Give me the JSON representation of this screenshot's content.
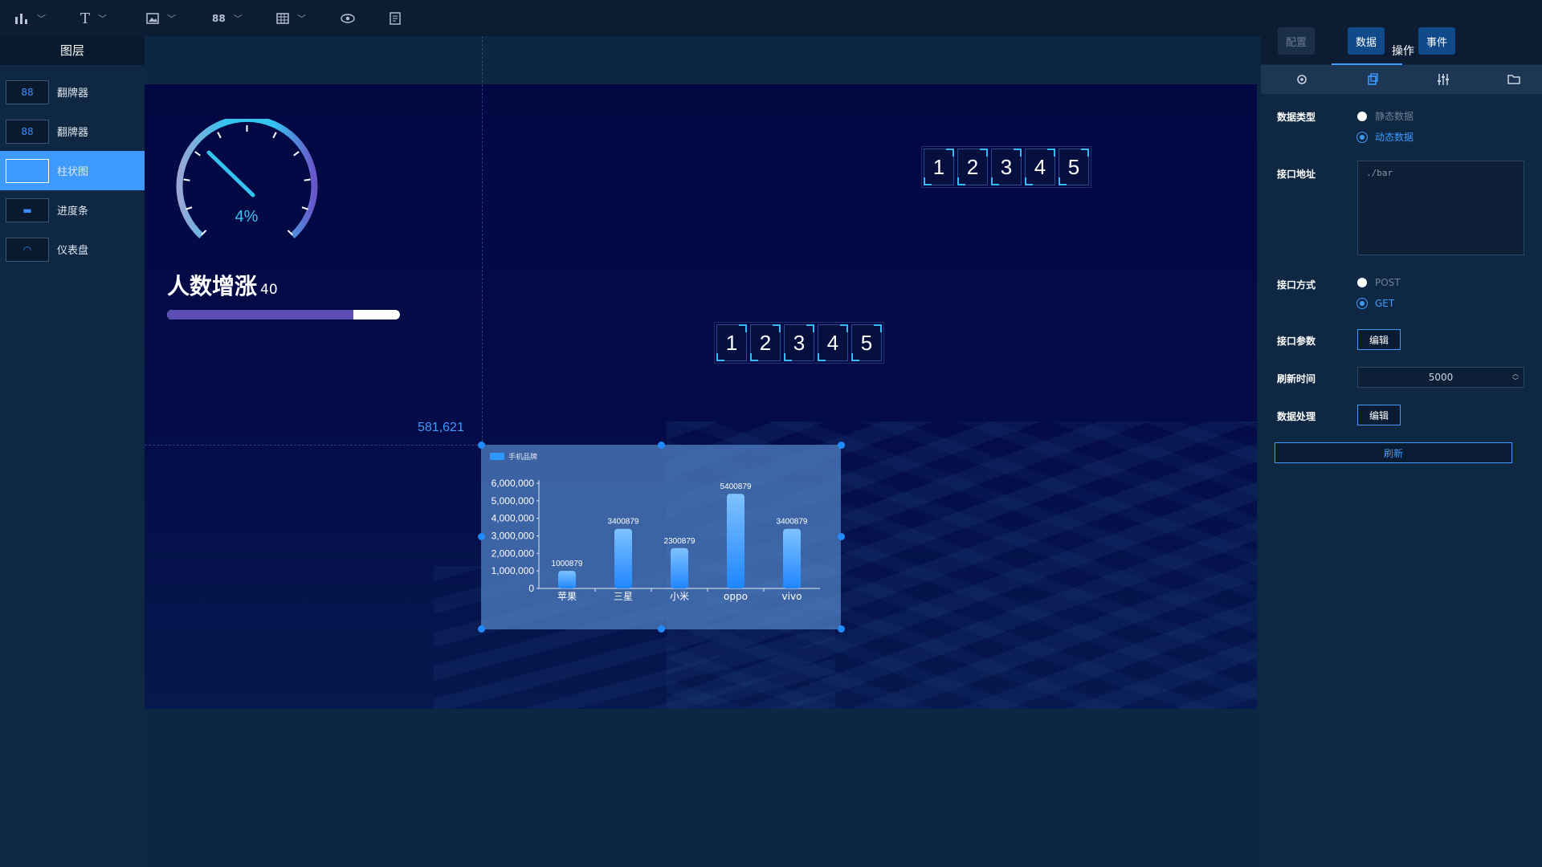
{
  "toolbar": {
    "tools": [
      {
        "icon": "bar-chart-icon"
      },
      {
        "icon": "text-icon",
        "glyph": "T"
      },
      {
        "icon": "image-icon"
      },
      {
        "icon": "flipper-icon",
        "glyph": "88"
      },
      {
        "icon": "table-icon"
      },
      {
        "icon": "eye-icon"
      },
      {
        "icon": "document-icon"
      }
    ]
  },
  "layers": {
    "title": "图层",
    "items": [
      {
        "label": "翻牌器",
        "thumb": "88"
      },
      {
        "label": "翻牌器",
        "thumb": "88"
      },
      {
        "label": "柱状图",
        "thumb": ""
      },
      {
        "label": "进度条",
        "thumb": "▬"
      },
      {
        "label": "仪表盘",
        "thumb": "◠"
      }
    ],
    "active_index": 2
  },
  "canvas": {
    "gauge_value": "4%",
    "title": "人数增涨",
    "title_value": "40",
    "progress_percent": 80,
    "coord_readout": "581,621",
    "flipper_top": [
      "1",
      "2",
      "3",
      "4",
      "5"
    ],
    "flipper_mid": [
      "1",
      "2",
      "3",
      "4",
      "5"
    ]
  },
  "chart_data": {
    "type": "bar",
    "legend": "手机品牌",
    "categories": [
      "苹果",
      "三星",
      "小米",
      "oppo",
      "vivo"
    ],
    "values": [
      1000879,
      3400879,
      2300879,
      5400879,
      3400879
    ],
    "value_labels": [
      "1000879",
      "3400879",
      "2300879",
      "5400879",
      "3400879"
    ],
    "y_ticks": [
      "0",
      "1,000,000",
      "2,000,000",
      "3,000,000",
      "4,000,000",
      "5,000,000",
      "6,000,000"
    ],
    "ylim": [
      0,
      6000000
    ],
    "bar_color": "#2e97ff"
  },
  "right_panel": {
    "tabs": {
      "config": "配置",
      "data": "数据",
      "event": "事件",
      "heading": "操作"
    },
    "icons": [
      "gear-icon",
      "copy-icon",
      "sliders-icon",
      "folder-icon"
    ],
    "data_type_label": "数据类型",
    "data_type_options": [
      "静态数据",
      "动态数据"
    ],
    "api_url_label": "接口地址",
    "api_url_value": "./bar",
    "api_method_label": "接口方式",
    "api_method_options": [
      "POST",
      "GET"
    ],
    "api_params_label": "接口参数",
    "edit_label": "编辑",
    "refresh_time_label": "刷新时间",
    "refresh_time_value": "5000",
    "data_process_label": "数据处理",
    "refresh_button": "刷新"
  }
}
